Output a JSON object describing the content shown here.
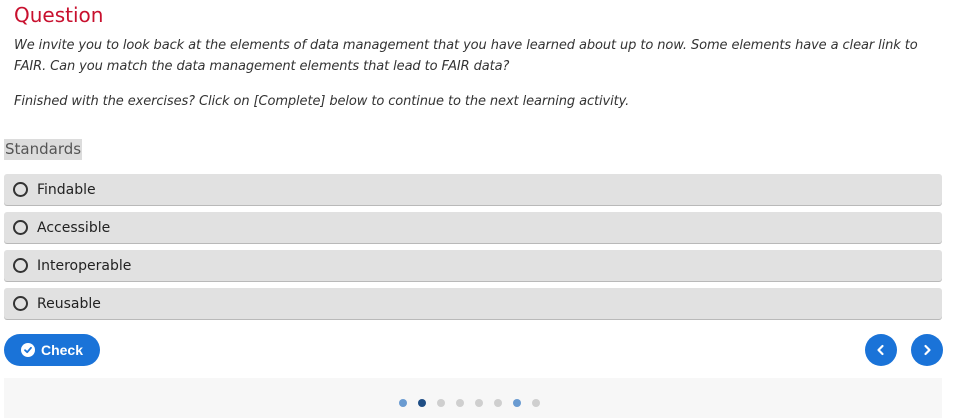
{
  "question": {
    "title": "Question",
    "prompt": "We invite you to look back at the elements of data management that you have learned about up to now. Some elements have a clear link to FAIR. Can you match the data management elements that lead to FAIR data?",
    "instruction": "Finished with the exercises? Click on [Complete] below to continue to the next learning activity.",
    "term": "Standards",
    "options": [
      {
        "label": "Findable",
        "selected": false
      },
      {
        "label": "Accessible",
        "selected": false
      },
      {
        "label": "Interoperable",
        "selected": false
      },
      {
        "label": "Reusable",
        "selected": false
      }
    ]
  },
  "actions": {
    "check_label": "Check",
    "check_icon": "check-circle-icon",
    "prev_icon": "chevron-left-icon",
    "next_icon": "chevron-right-icon"
  },
  "pagination": {
    "total": 8,
    "current": 2,
    "states": [
      "visited",
      "current",
      "unvisited",
      "unvisited",
      "unvisited",
      "unvisited",
      "visited",
      "unvisited"
    ]
  },
  "colors": {
    "accent": "#1a73d8",
    "title": "#c8102e",
    "option_bg": "#e1e1e1",
    "dot_current": "#1f4e85",
    "dot_visited": "#6a9bd1",
    "dot_unvisited": "#cfcfcf"
  }
}
